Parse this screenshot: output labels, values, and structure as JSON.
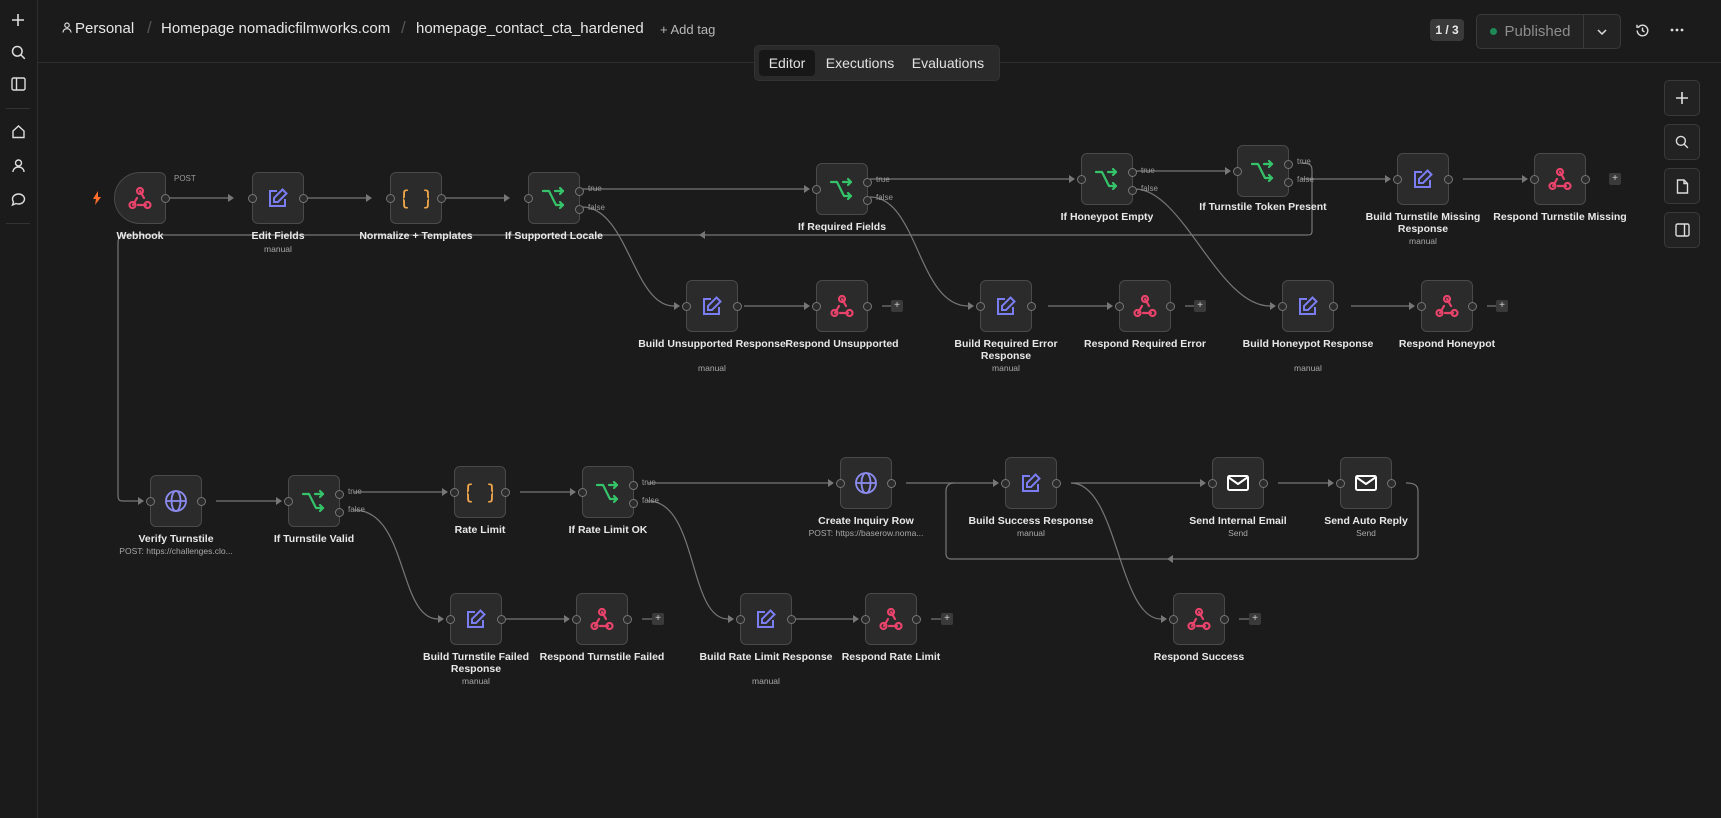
{
  "leftbar": {
    "icons": [
      "plus-icon",
      "search-icon",
      "sidebar-toggle-icon",
      "home-icon",
      "user-icon",
      "chat-icon"
    ]
  },
  "header": {
    "project": "Personal",
    "folder": "Homepage nomadicfilmworks.com",
    "workflow": "homepage_contact_cta_hardened",
    "add_tag": "+ Add tag",
    "pager": "1 / 3",
    "published": "Published"
  },
  "tabs": [
    "Editor",
    "Executions",
    "Evaluations"
  ],
  "colors": {
    "webhook": "#e8436b",
    "edit": "#7b7df3",
    "code": "#f0a64b",
    "if": "#35c46a",
    "http": "#8c8cf0",
    "email": "#ffffff",
    "published_dot": "#1f8a55",
    "trigger_bolt": "#ff6d2d"
  },
  "nodes": {
    "webhook": {
      "label": "Webhook",
      "io": "POST"
    },
    "edit_fields": {
      "label": "Edit Fields",
      "sub": "manual"
    },
    "normalize": {
      "label": "Normalize + Templates"
    },
    "if_locale": {
      "label": "If Supported Locale"
    },
    "if_required": {
      "label": "If Required Fields"
    },
    "if_honeypot": {
      "label": "If Honeypot Empty"
    },
    "if_turnstile_token": {
      "label": "If Turnstile Token Present"
    },
    "build_turnstile_missing": {
      "label": "Build Turnstile Missing Response",
      "sub": "manual"
    },
    "respond_turnstile_missing": {
      "label": "Respond Turnstile Missing"
    },
    "build_unsupported": {
      "label": "Build Unsupported Response",
      "sub": "manual"
    },
    "respond_unsupported": {
      "label": "Respond Unsupported"
    },
    "build_required_error": {
      "label": "Build Required Error Response",
      "sub": "manual"
    },
    "respond_required_error": {
      "label": "Respond Required Error"
    },
    "build_honeypot": {
      "label": "Build Honeypot Response",
      "sub": "manual"
    },
    "respond_honeypot": {
      "label": "Respond Honeypot"
    },
    "verify_turnstile": {
      "label": "Verify Turnstile",
      "sub": "POST: https://challenges.clo..."
    },
    "if_turnstile_valid": {
      "label": "If Turnstile Valid"
    },
    "rate_limit": {
      "label": "Rate Limit"
    },
    "if_rate_limit_ok": {
      "label": "If Rate Limit OK"
    },
    "create_inquiry": {
      "label": "Create Inquiry Row",
      "sub": "POST: https://baserow.noma..."
    },
    "build_success": {
      "label": "Build Success Response",
      "sub": "manual"
    },
    "send_internal": {
      "label": "Send Internal Email",
      "sub": "Send"
    },
    "send_auto": {
      "label": "Send Auto Reply",
      "sub": "Send"
    },
    "build_turnstile_failed": {
      "label": "Build Turnstile Failed Response",
      "sub": "manual"
    },
    "respond_turnstile_failed": {
      "label": "Respond Turnstile Failed"
    },
    "build_rate_limit": {
      "label": "Build Rate Limit Response",
      "sub": "manual"
    },
    "respond_rate_limit": {
      "label": "Respond Rate Limit"
    },
    "respond_success": {
      "label": "Respond Success"
    }
  },
  "branch": {
    "true": "true",
    "false": "false"
  },
  "plus": "+"
}
